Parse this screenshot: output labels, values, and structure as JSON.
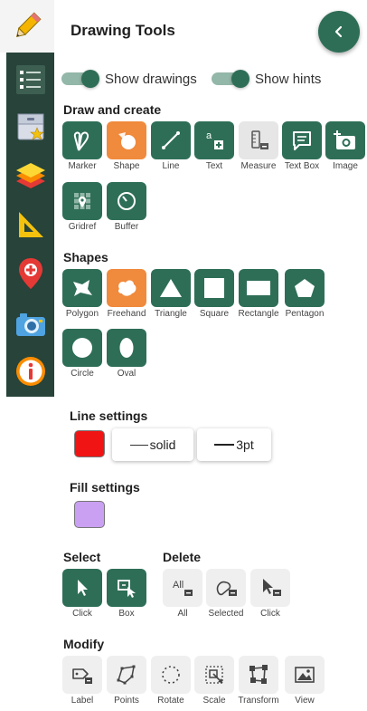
{
  "header": {
    "title": "Drawing Tools"
  },
  "rail": {
    "items": [
      {
        "icon": "pencil-icon"
      },
      {
        "icon": "list-icon"
      },
      {
        "icon": "drawer-star-icon"
      },
      {
        "icon": "layers-icon"
      },
      {
        "icon": "set-square-icon"
      },
      {
        "icon": "map-pin-icon"
      },
      {
        "icon": "camera-icon"
      },
      {
        "icon": "info-icon"
      }
    ]
  },
  "toggles": {
    "show_drawings": {
      "label": "Show drawings",
      "on": true
    },
    "show_hints": {
      "label": "Show hints",
      "on": true
    }
  },
  "draw_create": {
    "heading": "Draw and create",
    "tools": [
      {
        "label": "Marker",
        "style": "green",
        "icon": "marker-icon"
      },
      {
        "label": "Shape",
        "style": "orange",
        "icon": "shape-icon"
      },
      {
        "label": "Line",
        "style": "green",
        "icon": "line-icon"
      },
      {
        "label": "Text",
        "style": "green",
        "icon": "text-icon"
      },
      {
        "label": "Measure",
        "style": "grey",
        "icon": "measure-icon"
      },
      {
        "label": "Text Box",
        "style": "green",
        "icon": "text-box-icon"
      },
      {
        "label": "Image",
        "style": "green",
        "icon": "image-icon"
      },
      {
        "label": "Gridref",
        "style": "green",
        "icon": "gridref-icon"
      },
      {
        "label": "Buffer",
        "style": "green",
        "icon": "buffer-icon"
      }
    ]
  },
  "shapes": {
    "heading": "Shapes",
    "tools": [
      {
        "label": "Polygon",
        "style": "green",
        "icon": "polygon-icon"
      },
      {
        "label": "Freehand",
        "style": "orange",
        "icon": "freehand-icon"
      },
      {
        "label": "Triangle",
        "style": "green",
        "icon": "triangle-icon"
      },
      {
        "label": "Square",
        "style": "green",
        "icon": "square-icon"
      },
      {
        "label": "Rectangle",
        "style": "green",
        "icon": "rectangle-icon"
      },
      {
        "label": "Pentagon",
        "style": "green",
        "icon": "pentagon-icon"
      },
      {
        "label": "Circle",
        "style": "green",
        "icon": "circle-icon"
      },
      {
        "label": "Oval",
        "style": "green",
        "icon": "oval-icon"
      }
    ]
  },
  "line_settings": {
    "heading": "Line settings",
    "color": "#f01414",
    "style_label": "solid",
    "width_label": "3pt"
  },
  "fill_settings": {
    "heading": "Fill settings",
    "color": "#c9a0f2"
  },
  "select": {
    "heading": "Select",
    "tools": [
      {
        "label": "Click",
        "style": "green",
        "icon": "cursor-icon"
      },
      {
        "label": "Box",
        "style": "green",
        "icon": "box-select-icon"
      }
    ]
  },
  "delete": {
    "heading": "Delete",
    "tools": [
      {
        "label": "All",
        "glyph": "All",
        "style": "light",
        "icon": "delete-all-icon"
      },
      {
        "label": "Selected",
        "style": "light",
        "icon": "delete-selected-icon"
      },
      {
        "label": "Click",
        "style": "light",
        "icon": "delete-click-icon"
      }
    ]
  },
  "modify": {
    "heading": "Modify",
    "tools": [
      {
        "label": "Label",
        "style": "light",
        "icon": "label-icon"
      },
      {
        "label": "Points",
        "style": "light",
        "icon": "points-icon"
      },
      {
        "label": "Rotate",
        "style": "light",
        "icon": "rotate-icon"
      },
      {
        "label": "Scale",
        "style": "light",
        "icon": "scale-icon"
      },
      {
        "label": "Transform",
        "style": "light",
        "icon": "transform-icon"
      },
      {
        "label": "View",
        "style": "light",
        "icon": "view-icon"
      }
    ]
  },
  "colors": {
    "accent": "#2e6e57",
    "active": "#f08a3c",
    "rail": "#27433a"
  }
}
